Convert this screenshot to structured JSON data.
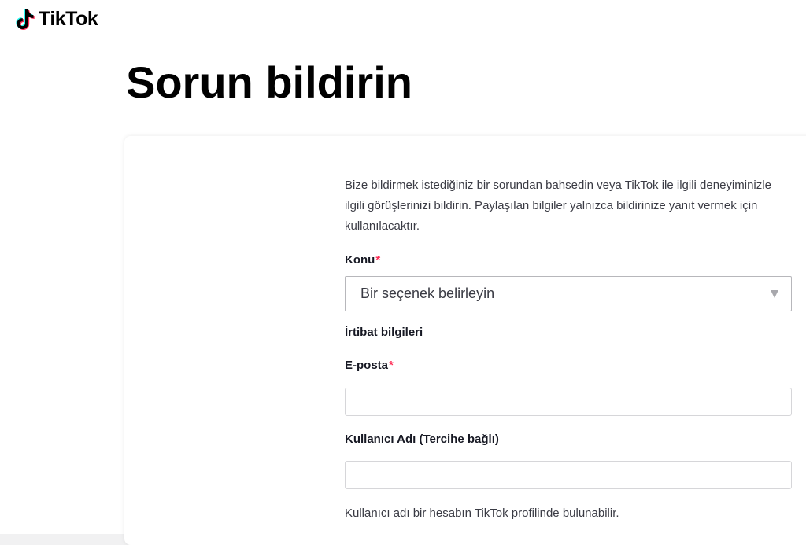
{
  "header": {
    "brand": "TikTok"
  },
  "page": {
    "title": "Sorun bildirin"
  },
  "form": {
    "intro": "Bize bildirmek istediğiniz bir sorundan bahsedin veya TikTok ile ilgili deneyiminizle ilgili görüşlerinizi bildirin. Paylaşılan bilgiler yalnızca bildirinize yanıt vermek için kullanılacaktır.",
    "topic": {
      "label": "Konu",
      "required_mark": "*",
      "selected": "Bir seçenek belirleyin"
    },
    "contact_section": "İrtibat bilgileri",
    "email": {
      "label": "E-posta",
      "required_mark": "*",
      "value": ""
    },
    "username": {
      "label": "Kullanıcı Adı (Tercihe bağlı)",
      "value": "",
      "help": "Kullanıcı adı bir hesabın TikTok profilinde bulunabilir."
    }
  },
  "colors": {
    "brand_black": "#000000",
    "required": "#fe2c55",
    "logo_cyan": "#25f4ee",
    "logo_red": "#fe2c55"
  },
  "icons": {
    "logo": "tiktok-note-icon",
    "select_arrow": "triangle-down-icon"
  }
}
